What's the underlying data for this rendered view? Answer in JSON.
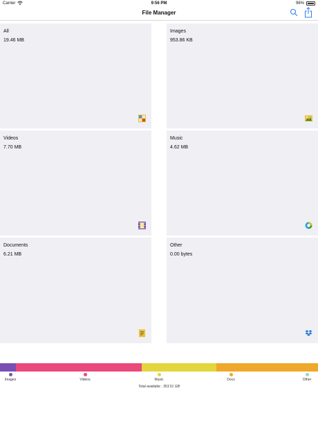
{
  "status": {
    "carrier": "Carrier",
    "time": "9:56 PM",
    "battery": "96%"
  },
  "nav": {
    "title": "File Manager"
  },
  "tiles": [
    {
      "label": "All",
      "size": "19.46 MB",
      "icon": "grid-icon"
    },
    {
      "label": "Images",
      "size": "953.86 KB",
      "icon": "photo-icon"
    },
    {
      "label": "Videos",
      "size": "7.70 MB",
      "icon": "film-icon"
    },
    {
      "label": "Music",
      "size": "4.62 MB",
      "icon": "music-icon"
    },
    {
      "label": "Documents",
      "size": "6.21 MB",
      "icon": "document-icon"
    },
    {
      "label": "Other",
      "size": "0.00 bytes",
      "icon": "dropbox-icon"
    }
  ],
  "storage": {
    "segments": [
      {
        "name": "Images",
        "color": "#7a4fb3",
        "fraction": 0.05
      },
      {
        "name": "Videos",
        "color": "#e9497c",
        "fraction": 0.395
      },
      {
        "name": "Music",
        "color": "#e3d53c",
        "fraction": 0.235
      },
      {
        "name": "Docs",
        "color": "#f0a82a",
        "fraction": 0.32
      }
    ],
    "legend": [
      {
        "label": "Images",
        "color": "#7a4fb3"
      },
      {
        "label": "Videos",
        "color": "#e9497c"
      },
      {
        "label": "Music",
        "color": "#e3d53c"
      },
      {
        "label": "Docs",
        "color": "#f0a82a"
      },
      {
        "label": "Other",
        "color": "#9fd3c0"
      }
    ],
    "total": "Total available : 353.51 GB"
  }
}
